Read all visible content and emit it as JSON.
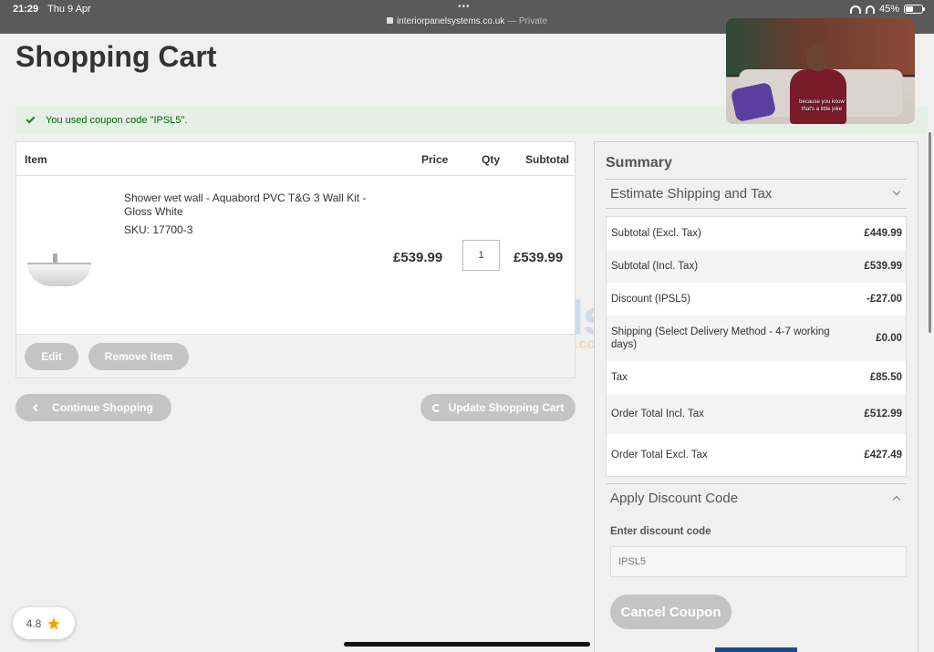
{
  "status": {
    "time": "21:29",
    "date": "Thu 9 Apr",
    "url": "interiorpanelsystems.co.uk",
    "private": "— Private",
    "battery": "45%"
  },
  "page": {
    "title": "Shopping Cart",
    "coupon_message": "You used coupon code \"IPSL5\"."
  },
  "video": {
    "caption_line1": "because you know",
    "caption_line2": "that's a little joke"
  },
  "cart": {
    "headers": {
      "item": "Item",
      "price": "Price",
      "qty": "Qty",
      "subtotal": "Subtotal"
    },
    "product": {
      "name": "Shower wet wall - Aquabord PVC T&G 3 Wall Kit - Gloss White",
      "sku": "SKU: 17700-3",
      "price": "£539.99",
      "qty": "1",
      "subtotal": "£539.99"
    },
    "edit_label": "Edit",
    "remove_label": "Remove item",
    "continue_label": "Continue Shopping",
    "update_label": "Update Shopping Cart"
  },
  "summary": {
    "title": "Summary",
    "estimate_label": "Estimate Shipping and Tax",
    "rows": [
      {
        "label": "Subtotal (Excl. Tax)",
        "value": "£449.99"
      },
      {
        "label": "Subtotal (Incl. Tax)",
        "value": "£539.99"
      },
      {
        "label": "Discount (IPSL5)",
        "value": "-£27.00"
      },
      {
        "label": "Shipping (Select Delivery Method - 4-7 working days)",
        "value": "£0.00"
      },
      {
        "label": "Tax",
        "value": "£85.50"
      },
      {
        "label": "Order Total Incl. Tax",
        "value": "£512.99"
      },
      {
        "label": "Order Total Excl. Tax",
        "value": "£427.49"
      }
    ],
    "discount_label": "Apply Discount Code",
    "enter_label": "Enter discount code",
    "discount_placeholder": "IPSL5",
    "cancel_label": "Cancel Coupon"
  },
  "watermark": {
    "main": "LatestDeals",
    "sub": ".co.uk"
  },
  "rating": {
    "value": "4.8"
  },
  "colors": {
    "accent_grey": "#c4c4c4",
    "success_green": "#006400",
    "star": "#f2a400"
  },
  "icons": [
    "check-icon",
    "lock-icon",
    "wifi-icon",
    "headphones-icon",
    "battery-icon",
    "chevron-left-icon",
    "refresh-icon",
    "chevron-down-icon",
    "chevron-up-icon",
    "star-icon",
    "lightning-icon"
  ]
}
